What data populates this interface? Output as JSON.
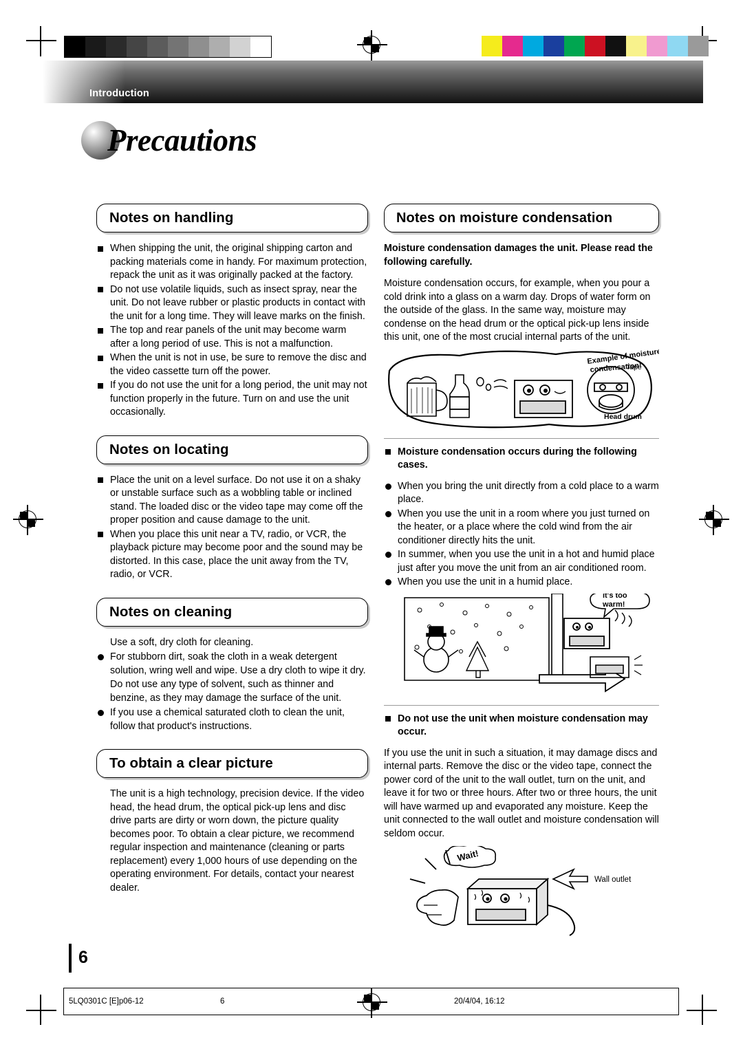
{
  "header": {
    "section_label": "Introduction",
    "title": "Precautions"
  },
  "left_column": {
    "handling": {
      "heading": "Notes on handling",
      "bullets": [
        "When shipping the unit, the original shipping carton and packing materials come in handy. For maximum protection, repack the unit as it was originally packed at the factory.",
        "Do not use volatile liquids, such as insect spray, near the unit. Do not leave rubber or plastic products in contact with the unit for a long time. They will leave marks on the finish.",
        "The top and rear panels of the unit may become warm after a long period of use. This is not a malfunction.",
        "When the unit is not in use, be sure to remove the disc and the video cassette turn off the power.",
        "If you do not use the unit for a long period, the unit may not function properly in the future. Turn on and use the unit occasionally."
      ]
    },
    "locating": {
      "heading": "Notes on locating",
      "bullets": [
        "Place the unit on a level surface. Do not use it on a shaky or unstable surface such as a wobbling table or inclined stand. The loaded disc or the video tape may come off the proper position and cause damage to the unit.",
        "When you place this unit near a TV, radio, or VCR, the playback picture may become poor and the sound may be distorted. In this case, place the unit away from the TV, radio, or VCR."
      ]
    },
    "cleaning": {
      "heading": "Notes on cleaning",
      "intro": "Use a soft, dry cloth for cleaning.",
      "bullets": [
        "For stubborn dirt, soak the cloth in a weak detergent solution, wring well and wipe. Use a dry cloth to wipe it dry.",
        "If you use a chemical saturated cloth to clean the unit, follow that product's instructions."
      ],
      "note": "Do not use any type of solvent, such as thinner and benzine, as they may damage the surface of the unit."
    },
    "clear_picture": {
      "heading": "To obtain a clear picture",
      "body": "The unit is a high technology, precision device. If the video head, the head drum, the optical pick-up lens and disc drive parts are dirty or worn down, the picture quality becomes poor. To obtain a clear picture, we recommend regular inspection and maintenance (cleaning or parts replacement) every 1,000 hours of use depending on the operating environment. For details, contact your nearest dealer."
    }
  },
  "right_column": {
    "moisture": {
      "heading": "Notes on moisture condensation",
      "lead": "Moisture condensation damages the unit. Please read the following carefully.",
      "body": "Moisture condensation occurs, for example, when you pour a cold drink into a glass on a warm day. Drops of water form on the outside of the glass. In the same way, moisture may condense on the head drum or the optical pick-up lens inside this unit, one of the most crucial internal parts of the unit.",
      "figure1_labels": {
        "caption": "Example of moisture condensation!",
        "tape": "Tape",
        "head_drum": "Head drum"
      },
      "cases_heading": "Moisture condensation occurs during the following cases.",
      "cases": [
        "When you bring the unit directly from a cold place to a warm place.",
        "When you use the unit in a room where you just turned on the heater, or a place where the cold wind from the air conditioner directly hits the unit.",
        "In summer, when you use the unit in a hot and humid place just after you move the unit from an air conditioned room.",
        "When you use the unit in a humid place."
      ],
      "figure2_labels": {
        "speech": "it's too warm!"
      },
      "warning_heading": "Do not use the unit when moisture condensation may occur.",
      "warning_body": "If you use the unit in such a situation, it may damage discs and internal parts. Remove the disc or the video tape, connect the power cord of the unit to the wall outlet, turn on the unit, and leave it for two or three hours. After two or three hours, the unit will have warmed up and evaporated any moisture. Keep the unit connected to the wall outlet and moisture condensation will seldom occur.",
      "figure3_labels": {
        "speech": "Wait!",
        "outlet": "Wall outlet"
      }
    }
  },
  "page_number": "6",
  "footer": {
    "left": "5LQ0301C [E]p06-12",
    "middle": "6",
    "right": "20/4/04, 16:12"
  },
  "colors": {
    "gray_swatches": [
      "#000000",
      "#1a1a1a",
      "#333333",
      "#4d4d4d",
      "#666666",
      "#808080",
      "#999999",
      "#b3b3b3",
      "#cccccc",
      "#ffffff"
    ],
    "color_swatches": [
      "#f4ec19",
      "#e8288f",
      "#00a7e1",
      "#1b3fa0",
      "#00a650",
      "#cc1122",
      "#111111",
      "#f7f07a",
      "#f09ad0",
      "#8fd8f2",
      "#9a9a9a"
    ]
  }
}
